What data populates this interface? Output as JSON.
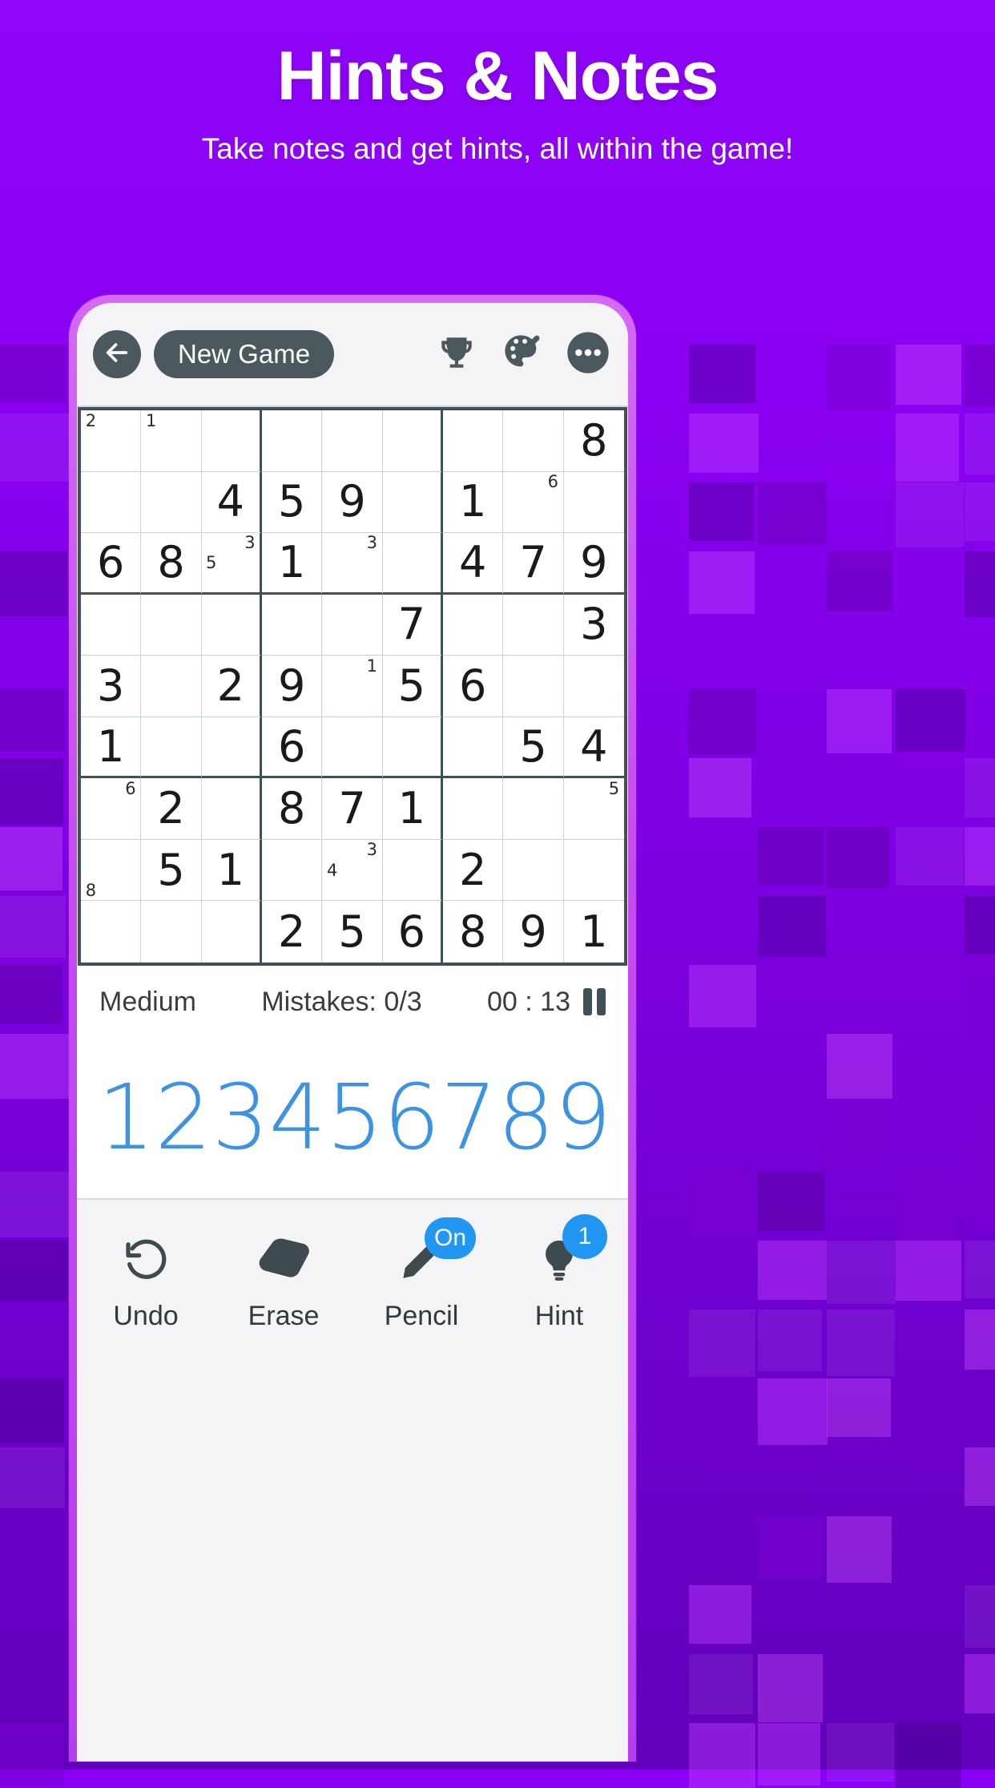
{
  "promo": {
    "title": "Hints & Notes",
    "subtitle": "Take notes and get hints, all within the game!",
    "bg_color": "#8a00f5",
    "phone_frame_color": "#c44cf0"
  },
  "appbar": {
    "back_icon": "arrow-left-icon",
    "new_game_label": "New Game",
    "trophy_icon": "trophy-icon",
    "theme_icon": "palette-brush-icon",
    "more_icon": "more-options-icon"
  },
  "status": {
    "difficulty": "Medium",
    "mistakes": "Mistakes: 0/3",
    "timer": "00 : 13",
    "pause_icon": "pause-icon"
  },
  "numpad": [
    "1",
    "2",
    "3",
    "4",
    "5",
    "6",
    "7",
    "8",
    "9"
  ],
  "bottombar": {
    "undo": {
      "label": "Undo",
      "icon": "undo-icon"
    },
    "erase": {
      "label": "Erase",
      "icon": "eraser-icon"
    },
    "pencil": {
      "label": "Pencil",
      "icon": "pencil-icon",
      "badge": "On",
      "badge_color": "#2196f3"
    },
    "hint": {
      "label": "Hint",
      "icon": "lightbulb-icon",
      "badge": "1",
      "badge_color": "#2196f3"
    }
  },
  "board": {
    "accent_number_color": "#3d93e0",
    "grid_line_color": "#c3d3e0",
    "grid_border_color": "#3f5056",
    "cells": [
      [
        {
          "v": "",
          "n": [
            "2"
          ],
          "np": [
            0
          ]
        },
        {
          "v": "",
          "n": [
            "1"
          ],
          "np": [
            0
          ]
        },
        {
          "v": ""
        },
        {
          "v": ""
        },
        {
          "v": ""
        },
        {
          "v": ""
        },
        {
          "v": ""
        },
        {
          "v": ""
        },
        {
          "v": "8"
        }
      ],
      [
        {
          "v": ""
        },
        {
          "v": ""
        },
        {
          "v": "4"
        },
        {
          "v": "5"
        },
        {
          "v": "9"
        },
        {
          "v": ""
        },
        {
          "v": "1"
        },
        {
          "v": "",
          "n": [
            "6"
          ],
          "np": [
            2
          ]
        },
        {
          "v": ""
        }
      ],
      [
        {
          "v": "6"
        },
        {
          "v": "8"
        },
        {
          "v": "",
          "n": [
            "3",
            "5"
          ],
          "np": [
            2,
            3
          ]
        },
        {
          "v": "1"
        },
        {
          "v": "",
          "n": [
            "3"
          ],
          "np": [
            2
          ]
        },
        {
          "v": ""
        },
        {
          "v": "4"
        },
        {
          "v": "7"
        },
        {
          "v": "9"
        }
      ],
      [
        {
          "v": ""
        },
        {
          "v": ""
        },
        {
          "v": ""
        },
        {
          "v": ""
        },
        {
          "v": ""
        },
        {
          "v": "7"
        },
        {
          "v": ""
        },
        {
          "v": ""
        },
        {
          "v": "3"
        }
      ],
      [
        {
          "v": "3"
        },
        {
          "v": ""
        },
        {
          "v": "2"
        },
        {
          "v": "9"
        },
        {
          "v": "",
          "n": [
            "1"
          ],
          "np": [
            2
          ]
        },
        {
          "v": "5"
        },
        {
          "v": "6"
        },
        {
          "v": ""
        },
        {
          "v": ""
        }
      ],
      [
        {
          "v": "1"
        },
        {
          "v": ""
        },
        {
          "v": ""
        },
        {
          "v": "6"
        },
        {
          "v": ""
        },
        {
          "v": ""
        },
        {
          "v": ""
        },
        {
          "v": "5"
        },
        {
          "v": "4"
        }
      ],
      [
        {
          "v": "",
          "n": [
            "6"
          ],
          "np": [
            2
          ]
        },
        {
          "v": "2"
        },
        {
          "v": ""
        },
        {
          "v": "8"
        },
        {
          "v": "7"
        },
        {
          "v": "1"
        },
        {
          "v": ""
        },
        {
          "v": ""
        },
        {
          "v": "",
          "n": [
            "5"
          ],
          "np": [
            2
          ]
        }
      ],
      [
        {
          "v": "",
          "n": [
            "8"
          ],
          "np": [
            6
          ]
        },
        {
          "v": "5"
        },
        {
          "v": "1"
        },
        {
          "v": ""
        },
        {
          "v": "",
          "n": [
            "4",
            "3"
          ],
          "np": [
            3,
            2
          ]
        },
        {
          "v": ""
        },
        {
          "v": "2"
        },
        {
          "v": ""
        },
        {
          "v": ""
        }
      ],
      [
        {
          "v": ""
        },
        {
          "v": ""
        },
        {
          "v": ""
        },
        {
          "v": "2"
        },
        {
          "v": "5"
        },
        {
          "v": "6"
        },
        {
          "v": "8"
        },
        {
          "v": "9"
        },
        {
          "v": "1"
        }
      ]
    ]
  }
}
